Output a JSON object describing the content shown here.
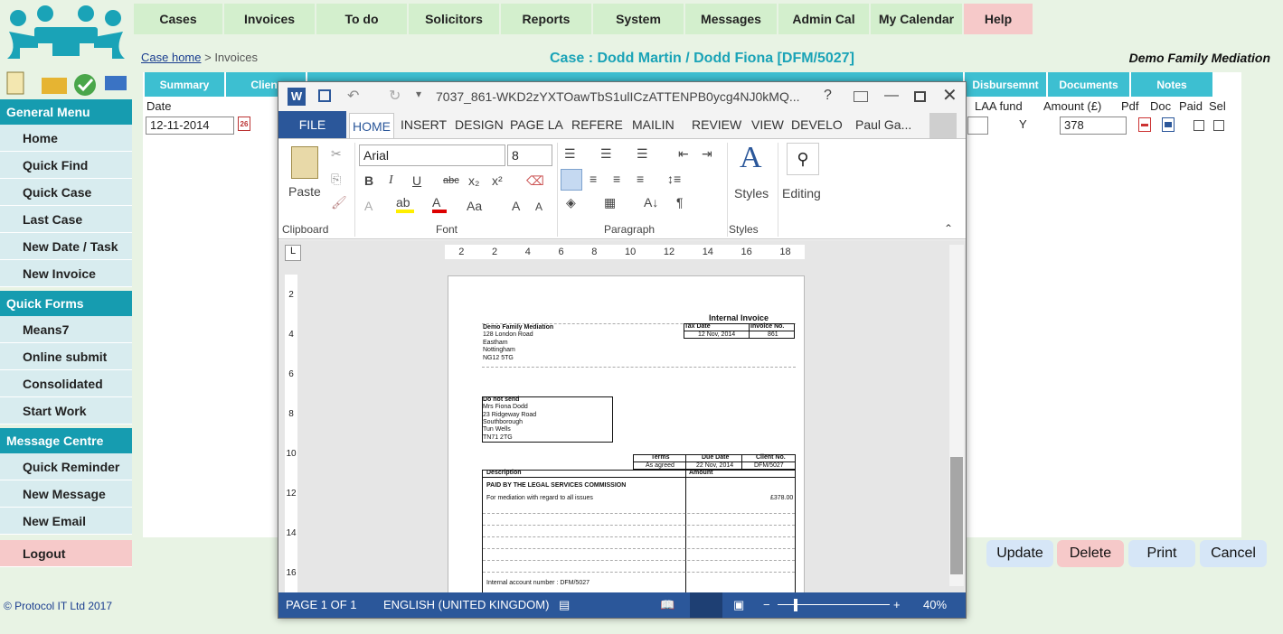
{
  "topnav": [
    "Cases",
    "Invoices",
    "To do",
    "Solicitors",
    "Reports",
    "System",
    "Messages",
    "Admin Cal",
    "My Calendar",
    "Help"
  ],
  "breadcrumb": {
    "link": "Case home",
    "sep": " > ",
    "current": "Invoices"
  },
  "case_title": "Case : Dodd Martin / Dodd Fiona [DFM/5027]",
  "firm": "Demo Family Mediation",
  "tabs": [
    "Summary",
    "Client",
    "Disbursemnt",
    "Documents",
    "Notes"
  ],
  "left_menu": {
    "general_header": "General Menu",
    "general": [
      "Home",
      "Quick Find",
      "Quick Case",
      "Last Case",
      "New Date / Task",
      "New Invoice"
    ],
    "forms_header": "Quick Forms",
    "forms": [
      "Means7",
      "Online submit",
      "Consolidated",
      "Start Work"
    ],
    "messages_header": "Message Centre",
    "messages": [
      "Quick Reminder",
      "New Message",
      "New Email"
    ],
    "logout": "Logout"
  },
  "copyright": "© Protocol IT Ltd 2017",
  "table": {
    "headers": {
      "date": "Date",
      "laa": "LAA fund",
      "amount": "Amount (£)",
      "pdf": "Pdf",
      "doc": "Doc",
      "paid": "Paid",
      "sel": "Sel"
    },
    "row": {
      "date": "12-11-2014",
      "laa": "Y",
      "amount": "378"
    }
  },
  "actions": {
    "update": "Update",
    "delete": "Delete",
    "print": "Print",
    "cancel": "Cancel"
  },
  "colors": {
    "accent": "#1aa3b7",
    "nav": "#d3efcd",
    "menu_header": "#169cb0",
    "word_blue": "#2b579a",
    "delete": "#f6c9c9",
    "button": "#d6e6f7"
  },
  "word": {
    "title": "7037_861-WKD2zYXTOawTbS1ulICzATTENPB0ycg4NJ0kMQ...",
    "ribbon_tabs": [
      "FILE",
      "HOME",
      "INSERT",
      "DESIGN",
      "PAGE LA",
      "REFERE",
      "MAILIN",
      "REVIEW",
      "VIEW",
      "DEVELO"
    ],
    "user": "Paul Ga...",
    "font": "Arial",
    "font_size": "8",
    "groups": {
      "clipboard": "Clipboard",
      "font": "Font",
      "paragraph": "Paragraph",
      "styles": "Styles"
    },
    "paste": "Paste",
    "styles_btn": "Styles",
    "editing_btn": "Editing",
    "ruler": [
      "2",
      "2",
      "4",
      "6",
      "8",
      "10",
      "12",
      "14",
      "16",
      "18"
    ],
    "vruler": [
      "2",
      "4",
      "6",
      "8",
      "10",
      "12",
      "14",
      "16"
    ],
    "status": {
      "page": "PAGE 1 OF 1",
      "lang": "ENGLISH (UNITED KINGDOM)",
      "zoom": "40%"
    },
    "doc": {
      "heading": "Internal Invoice",
      "firm": "Demo Family Mediation",
      "address": [
        "128 London Road",
        "Eastham",
        "Nottingham",
        "NG12 5TG"
      ],
      "tax_date_label": "Tax Date",
      "invoice_no_label": "Invoice No.",
      "tax_date": "12 Nov, 2014",
      "invoice_no": "861",
      "recipient": [
        "Do not send",
        "Mrs Fiona Dodd",
        "23 Ridgeway Road",
        "Southborough",
        "Tun Wells",
        "TN71 2TG"
      ],
      "terms_label": "Terms",
      "due_label": "Due Date",
      "client_label": "Client No.",
      "terms": "As agreed",
      "due": "22 Nov, 2014",
      "client": "DFM/5027",
      "desc_label": "Description",
      "amount_label": "Amount",
      "paid_by": "PAID BY THE LEGAL SERVICES COMMISSION",
      "line_desc": "For mediation with regard to all issues",
      "line_amount": "£378.00",
      "footer": "Internal account number : DFM/5027"
    }
  }
}
